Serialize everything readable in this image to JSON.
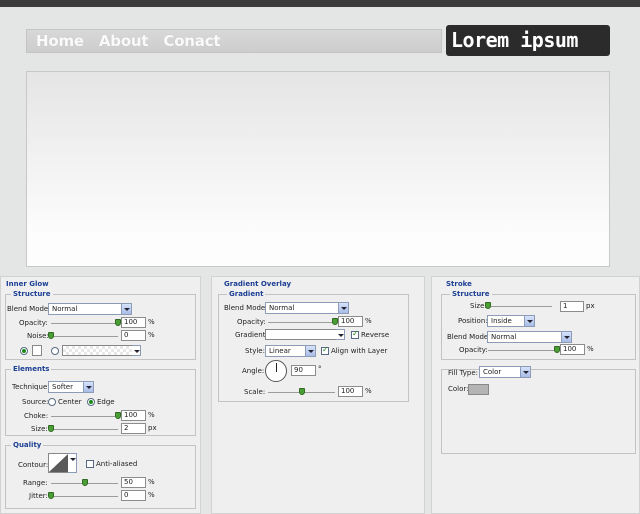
{
  "site": {
    "nav": [
      "Home",
      "About",
      "Conact"
    ],
    "logo": "Lorem ipsum"
  },
  "inner_glow": {
    "title": "Inner Glow",
    "structure": {
      "legend": "Structure",
      "blend_mode_label": "Blend Mode:",
      "blend_mode_value": "Normal",
      "opacity_label": "Opacity:",
      "opacity_value": "100",
      "opacity_level": 1.0,
      "noise_label": "Noise:",
      "noise_value": "0",
      "noise_level": 0.0,
      "unit": "%"
    },
    "elements": {
      "legend": "Elements",
      "technique_label": "Technique:",
      "technique_value": "Softer",
      "source_label": "Source:",
      "source_center": "Center",
      "source_edge": "Edge",
      "choke_label": "Choke:",
      "choke_value": "100",
      "choke_level": 1.0,
      "size_label": "Size:",
      "size_value": "2",
      "size_level": 0.0,
      "unit": "%",
      "size_unit": "px"
    },
    "quality": {
      "legend": "Quality",
      "contour_label": "Contour:",
      "anti_aliased_label": "Anti-aliased",
      "range_label": "Range:",
      "range_value": "50",
      "range_level": 0.5,
      "jitter_label": "Jitter:",
      "jitter_value": "0",
      "jitter_level": 0.0,
      "unit": "%"
    }
  },
  "gradient_overlay": {
    "title": "Gradient Overlay",
    "legend": "Gradient",
    "blend_mode_label": "Blend Mode:",
    "blend_mode_value": "Normal",
    "opacity_label": "Opacity:",
    "opacity_value": "100",
    "opacity_level": 1.0,
    "gradient_label": "Gradient:",
    "reverse_label": "Reverse",
    "style_label": "Style:",
    "style_value": "Linear",
    "align_label": "Align with Layer",
    "angle_label": "Angle:",
    "angle_value": "90",
    "angle_unit": "°",
    "scale_label": "Scale:",
    "scale_value": "100",
    "scale_level": 0.5,
    "unit": "%"
  },
  "stroke": {
    "title": "Stroke",
    "legend": "Structure",
    "size_label": "Size:",
    "size_value": "1",
    "size_level": 0.0,
    "size_unit": "px",
    "position_label": "Position:",
    "position_value": "Inside",
    "blend_mode_label": "Blend Mode:",
    "blend_mode_value": "Normal",
    "opacity_label": "Opacity:",
    "opacity_value": "100",
    "opacity_level": 1.0,
    "unit": "%",
    "fill_type_label": "Fill Type:",
    "fill_type_value": "Color",
    "color_label": "Color:",
    "color_swatch": "#b4b4b4"
  }
}
